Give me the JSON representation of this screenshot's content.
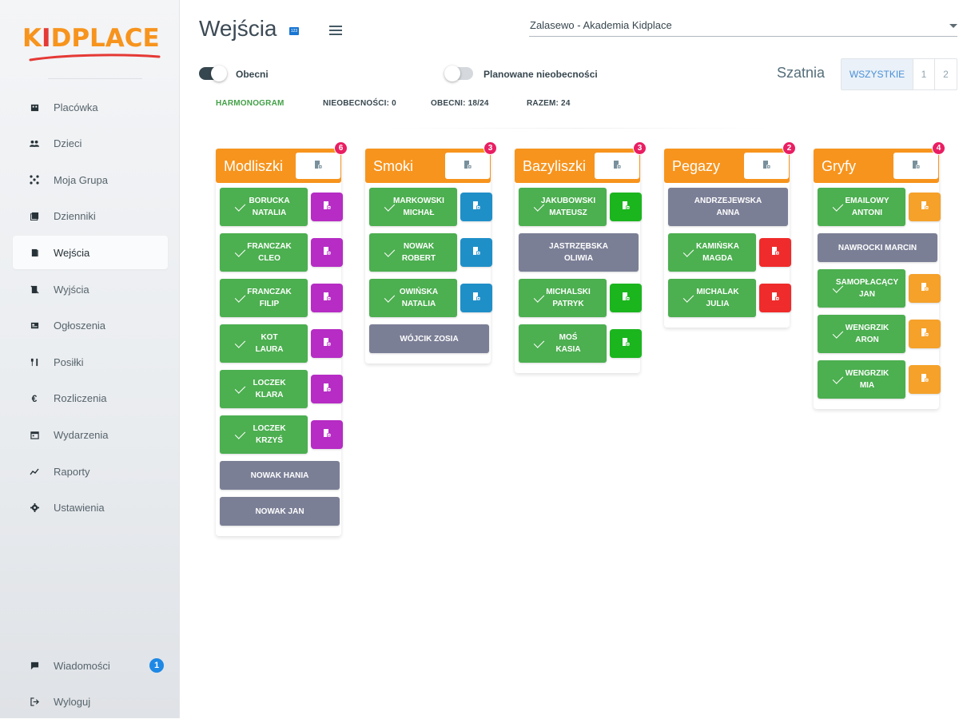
{
  "sidebar": {
    "logo": {
      "text": "KIDPLACE"
    },
    "items": [
      {
        "label": "Placówka",
        "icon": "building-icon"
      },
      {
        "label": "Dzieci",
        "icon": "children-icon"
      },
      {
        "label": "Moja Grupa",
        "icon": "group-icon"
      },
      {
        "label": "Dzienniki",
        "icon": "journal-icon"
      },
      {
        "label": "Wejścia",
        "icon": "door-enter-icon",
        "active": true
      },
      {
        "label": "Wyjścia",
        "icon": "door-exit-icon"
      },
      {
        "label": "Ogłoszenia",
        "icon": "announcement-icon"
      },
      {
        "label": "Posiłki",
        "icon": "cutlery-icon"
      },
      {
        "label": "Rozliczenia",
        "icon": "euro-icon"
      },
      {
        "label": "Wydarzenia",
        "icon": "calendar-icon"
      },
      {
        "label": "Raporty",
        "icon": "chart-icon"
      },
      {
        "label": "Ustawienia",
        "icon": "gear-icon"
      }
    ],
    "bottom": [
      {
        "label": "Wiadomości",
        "icon": "message-icon",
        "badge": "1"
      },
      {
        "label": "Wyloguj",
        "icon": "logout-icon"
      }
    ]
  },
  "header": {
    "title": "Wejścia",
    "branch": "Zalasewo - Akademia Kidplace"
  },
  "filters": {
    "obecni_label": "Obecni",
    "obecni_on": true,
    "planned_label": "Planowane nieobecności",
    "planned_on": false,
    "szatnia_label": "Szatnia",
    "szatnia_options": [
      "WSZYSTKIE",
      "1",
      "2"
    ],
    "szatnia_selected": "WSZYSTKIE"
  },
  "stats": {
    "harmonogram": "HARMONOGRAM",
    "nieobecnosci": "NIEOBECNOŚCI: 0",
    "obecni": "OBECNI: 18/24",
    "razem": "RAZEM: 24"
  },
  "colors": {
    "accent": "#f7941d",
    "present": "#4caf50",
    "absent": "#7b7f96",
    "badge": "#e91e63"
  },
  "groups": [
    {
      "name": "Modliszki",
      "count": "6",
      "door_color": "#b62cc4",
      "kids": [
        {
          "line1": "BORUCKA",
          "line2": "NATALIA",
          "present": true
        },
        {
          "line1": "FRANCZAK",
          "line2": "CLEO",
          "present": true
        },
        {
          "line1": "FRANCZAK",
          "line2": "FILIP",
          "present": true
        },
        {
          "line1": "KOT",
          "line2": "LAURA",
          "present": true
        },
        {
          "line1": "LOCZEK",
          "line2": "KLARA",
          "present": true
        },
        {
          "line1": "LOCZEK",
          "line2": "KRZYŚ",
          "present": true
        },
        {
          "line1": "NOWAK HANIA",
          "line2": "",
          "present": false
        },
        {
          "line1": "NOWAK JAN",
          "line2": "",
          "present": false
        }
      ]
    },
    {
      "name": "Smoki",
      "count": "3",
      "door_color": "#1f8fc8",
      "kids": [
        {
          "line1": "MARKOWSKI",
          "line2": "MICHAŁ",
          "present": true
        },
        {
          "line1": "NOWAK",
          "line2": "ROBERT",
          "present": true
        },
        {
          "line1": "OWIŃSKA",
          "line2": "NATALIA",
          "present": true
        },
        {
          "line1": "WÓJCIK ZOSIA",
          "line2": "",
          "present": false
        }
      ]
    },
    {
      "name": "Bazyliszki",
      "count": "3",
      "door_color": "#1bb51e",
      "kids": [
        {
          "line1": "JAKUBOWSKI",
          "line2": "MATEUSZ",
          "present": true
        },
        {
          "line1": "JASTRZĘBSKA",
          "line2": "OLIWIA",
          "present": false
        },
        {
          "line1": "MICHALSKI",
          "line2": "PATRYK",
          "present": true
        },
        {
          "line1": "MOŚ",
          "line2": "KASIA",
          "present": true
        }
      ]
    },
    {
      "name": "Pegazy",
      "count": "2",
      "door_color": "#ef2b2b",
      "kids": [
        {
          "line1": "ANDRZEJEWSKA",
          "line2": "ANNA",
          "present": false
        },
        {
          "line1": "KAMIŃSKA",
          "line2": "MAGDA",
          "present": true
        },
        {
          "line1": "MICHALAK",
          "line2": "JULIA",
          "present": true
        }
      ]
    },
    {
      "name": "Gryfy",
      "count": "4",
      "door_color": "#f5a12a",
      "kids": [
        {
          "line1": "EMAILOWY",
          "line2": "ANTONI",
          "present": true
        },
        {
          "line1": "NAWROCKI MARCIN",
          "line2": "",
          "present": false
        },
        {
          "line1": "SAMOPŁACĄCY",
          "line2": "JAN",
          "present": true
        },
        {
          "line1": "WENGRZIK",
          "line2": "ARON",
          "present": true
        },
        {
          "line1": "WENGRZIK",
          "line2": "MIA",
          "present": true
        }
      ]
    }
  ]
}
